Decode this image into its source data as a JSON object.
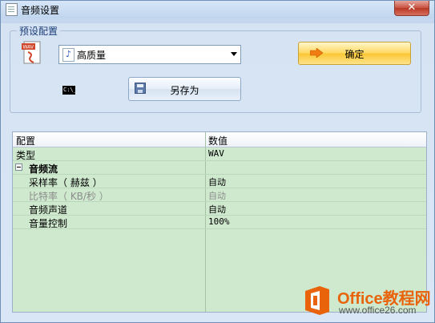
{
  "window": {
    "title": "音频设置",
    "close_label": "✕"
  },
  "preset": {
    "group_label": "预设配置",
    "selected": "高质量",
    "ok_label": "确定",
    "save_as_label": "另存为"
  },
  "grid": {
    "headers": [
      "配置",
      "数值"
    ],
    "rows": [
      {
        "key": "类型",
        "value": "WAV"
      },
      {
        "key": "音频流",
        "value": ""
      },
      {
        "key": "采样率（ 赫兹 ）",
        "value": "自动"
      },
      {
        "key": "比特率（ KB/秒 ）",
        "value": "自动"
      },
      {
        "key": "音频声道",
        "value": "自动"
      },
      {
        "key": "音量控制",
        "value": "100%"
      }
    ]
  },
  "watermark": {
    "brand": "Office教程网",
    "url": "www.office26.com"
  },
  "icons": {
    "file": "wav-file-icon",
    "note": "music-note-icon",
    "console": "console-icon",
    "disk": "floppy-disk-icon",
    "arrow": "orange-arrow-icon"
  },
  "colors": {
    "grid_background": "#cfe9cf",
    "ok_button": "#ffd860",
    "close_button": "#c7503f",
    "brand_orange": "#e8630a"
  }
}
